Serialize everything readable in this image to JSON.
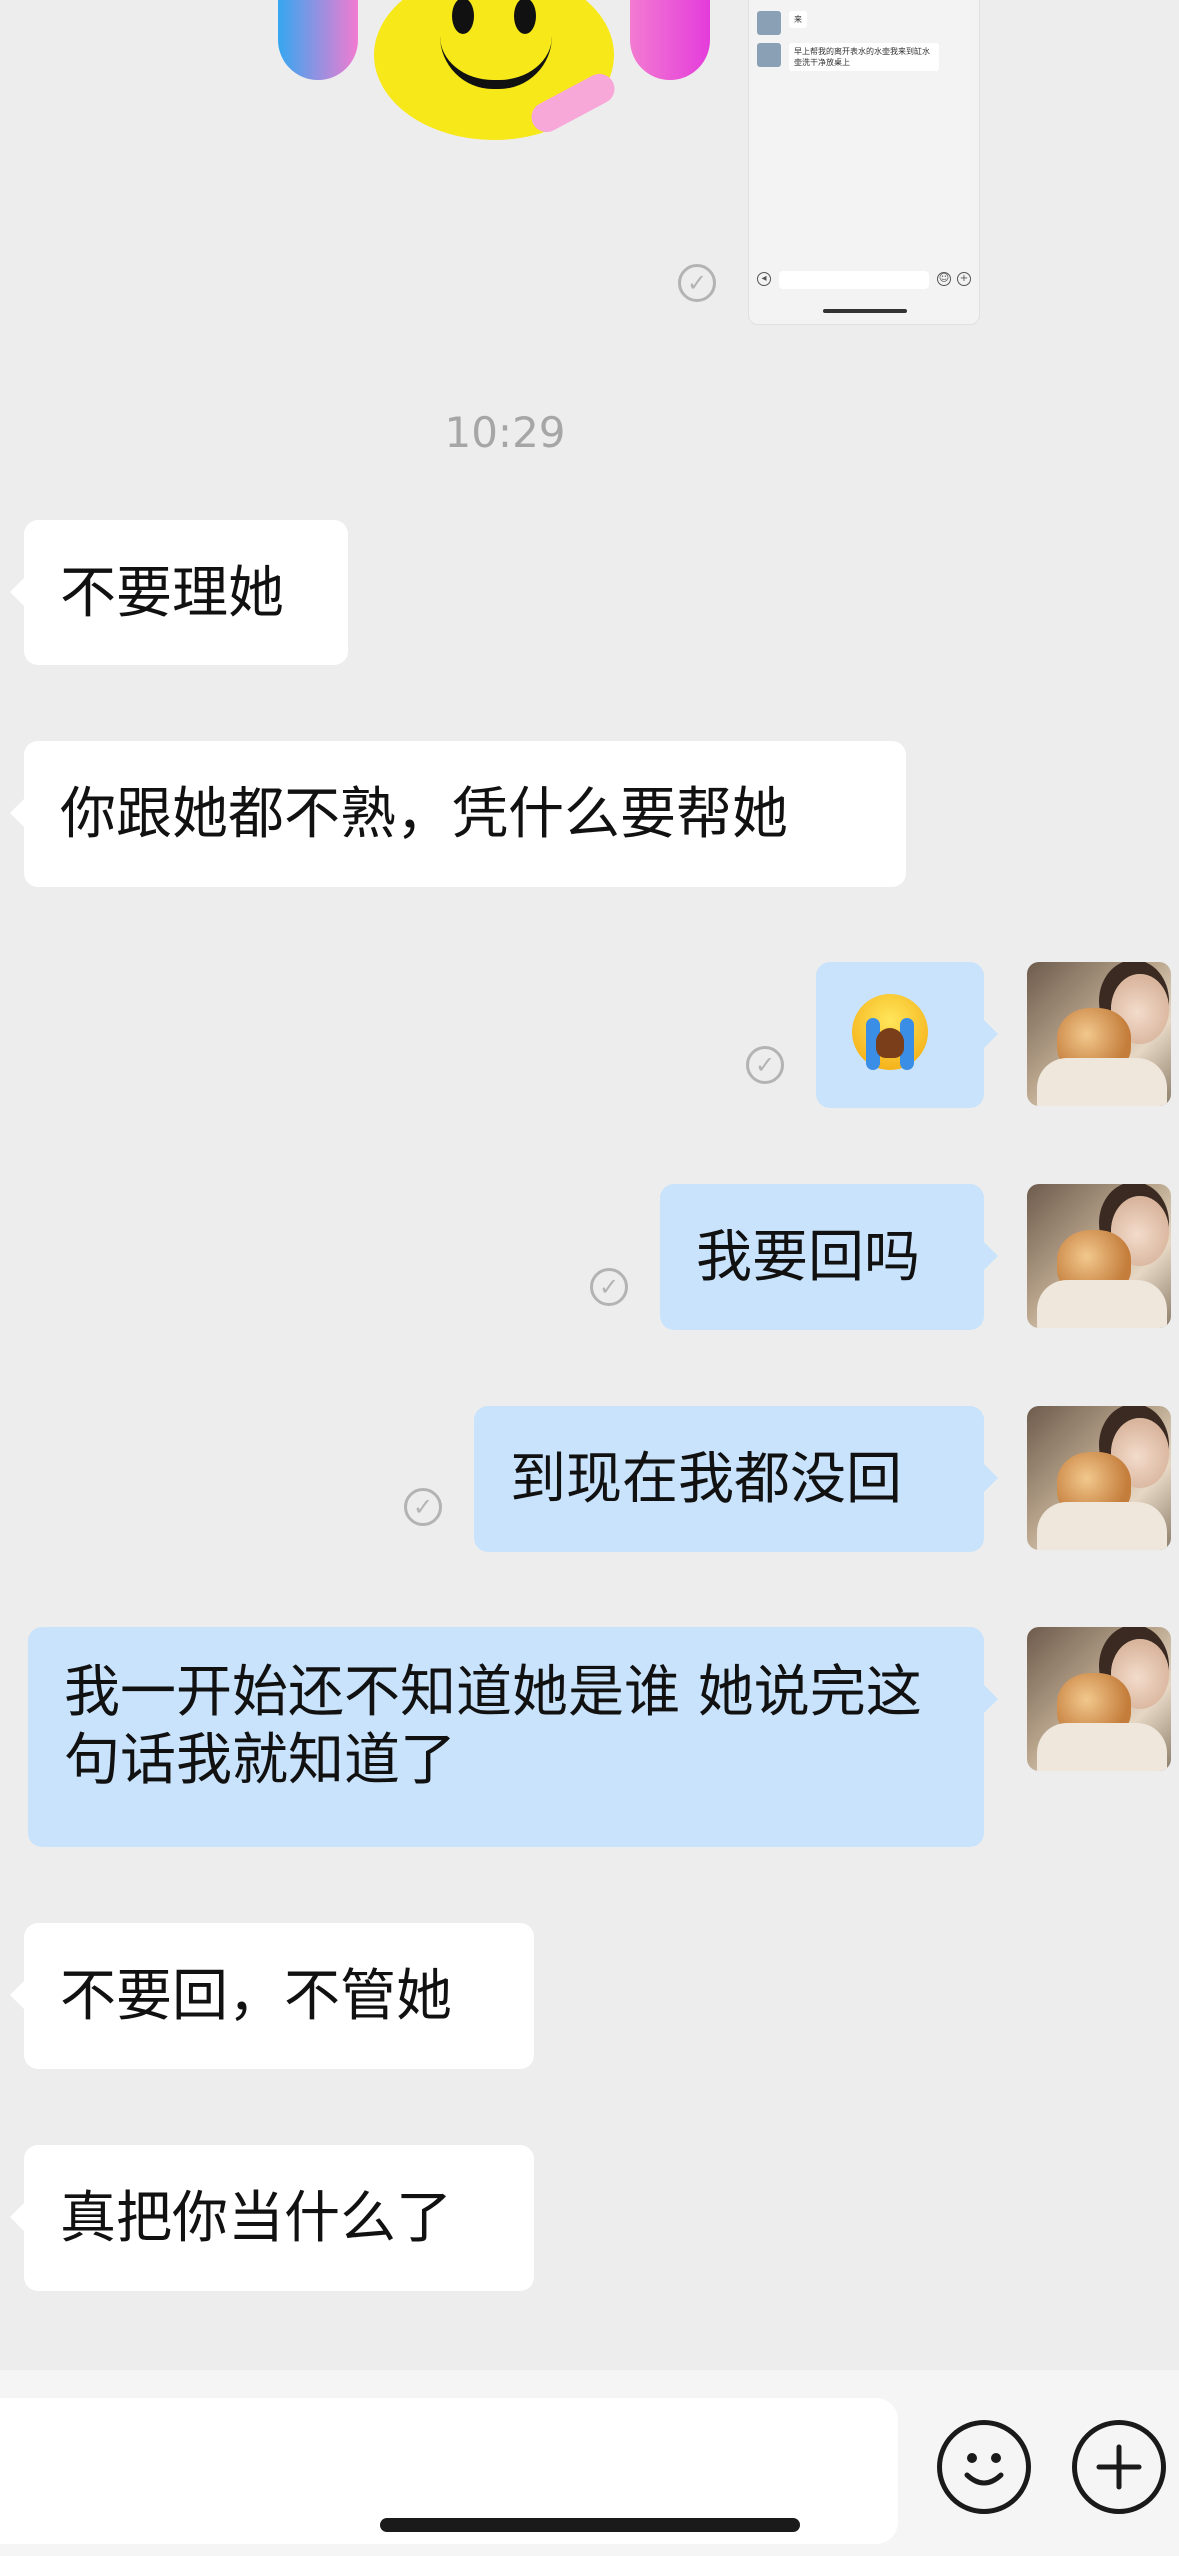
{
  "conversation": {
    "top_sticker": {
      "icon": "smiley-headset-sticker-icon"
    },
    "top_screenshot": {
      "icon": "chat-screenshot-thumbnail-icon",
      "lines": [
        "来",
        "早上帮我的离开表水的水壶我来到缸水壶洗干净放桌上"
      ]
    },
    "timestamp": "10:29",
    "messages": [
      {
        "side": "left",
        "text": "不要理她"
      },
      {
        "side": "left",
        "text": "你跟她都不熟，凭什么要帮她"
      },
      {
        "side": "right",
        "emoji": "loudly-crying-face-icon"
      },
      {
        "side": "right",
        "text": "我要回吗"
      },
      {
        "side": "right",
        "text": "到现在我都没回"
      },
      {
        "side": "right",
        "text": "我一开始还不知道她是谁 她说完这句话我就知道了"
      },
      {
        "side": "left",
        "text": "不要回，不管她"
      },
      {
        "side": "left",
        "text": "真把你当什么了"
      }
    ]
  },
  "input_bar": {
    "text_value": "",
    "emoji_button_icon": "smiley-face-icon",
    "more_button_icon": "plus-circle-icon"
  },
  "colors": {
    "background": "#EDEDED",
    "incoming_bubble": "#FFFFFF",
    "outgoing_bubble": "#C8E3FB",
    "timestamp_text": "#A6A6A6",
    "read_check": "#B3B3B3"
  }
}
